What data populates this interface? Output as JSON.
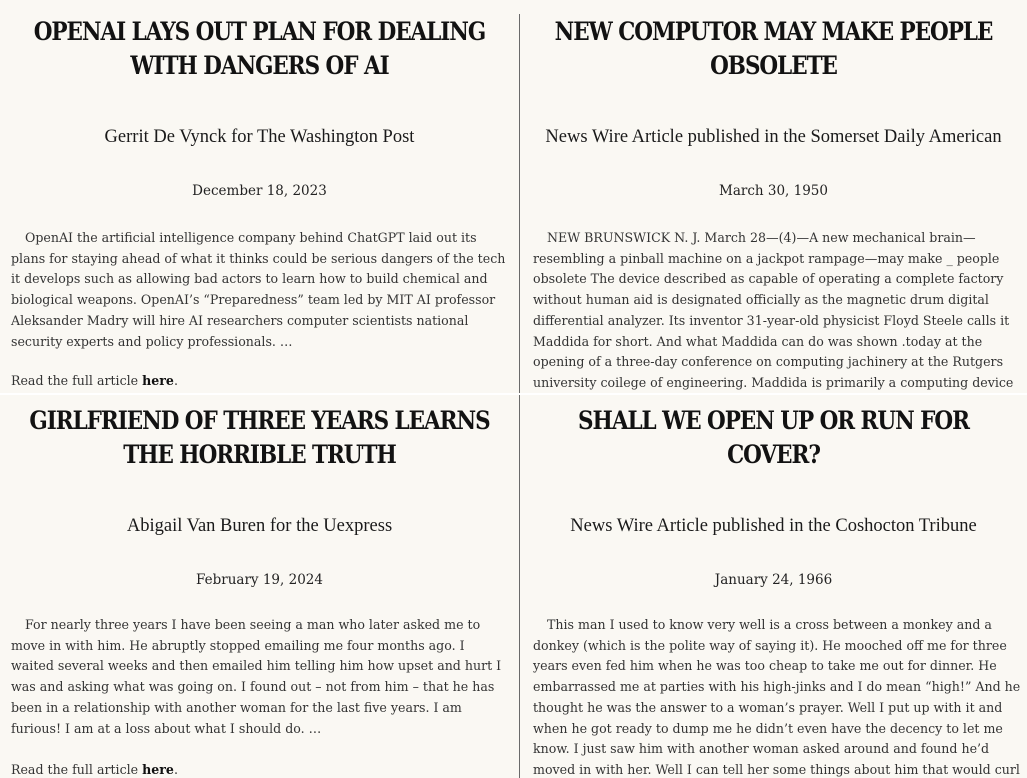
{
  "articles": [
    {
      "headline": "OpenAI lays out plan for dealing with dangers of AI",
      "byline": "Gerrit De Vynck for The Washington Post",
      "date": "December 18, 2023",
      "body": "OpenAI the artificial intelligence company behind ChatGPT laid out its plans for staying ahead of what it thinks could be serious dangers of the tech it develops such as allowing bad actors to learn how to build chemical and biological weapons. OpenAI’s “Preparedness” team led by MIT AI professor Aleksander Madry will hire AI researchers computer scientists national security experts and policy professionals. …",
      "read_prefix": "Read the full article ",
      "link_label": "here",
      "read_suffix": "."
    },
    {
      "headline": "New computor may make people obsolete",
      "byline": "News Wire Article published in the Somerset Daily American",
      "date": "March 30, 1950",
      "body": "NEW BRUNSWICK N. J. March 28—(4)—A new mechanical brain—resembling a pinball machine on a jackpot rampage—may make _ people obsolete The device described as capable of operating a complete factory without human aid is designated officially as the magnetic drum digital differential analyzer. Its inventor 31-year-old physicist Floyd Steele calls it Maddida for short. And what Maddida can do was shown .today at the opening of a three-day conference on computing jachinery at the Rutgers university coilege of engineering. Maddida is primarily a computing device"
    },
    {
      "headline": "Girlfriend of three years learns the horrible truth",
      "byline": "Abigail Van Buren for the Uexpress",
      "date": "February 19, 2024",
      "body": "For nearly three years I have been seeing a man who later asked me to move in with him. He abruptly stopped emailing me four months ago. I waited several weeks and then emailed him telling him how upset and hurt I was and asking what was going on. I found out – not from him – that he has been in a relationship with another woman for the last five years. I am furious! I am at a loss about what I should do. …",
      "read_prefix": "Read the full article ",
      "link_label": "here",
      "read_suffix": "."
    },
    {
      "headline": "Shall we open up or run for cover?",
      "byline": "News Wire Article published in the Coshocton Tribune",
      "date": "January 24, 1966",
      "body": "This man I used to know very well is a cross between a monkey and a donkey (which is the polite way of saying it). He mooched off me for three years even fed him when he was too cheap to take me out for dinner. He embarrassed me at parties with his high-jinks and I do mean “high!” And he thought he was the answer to a woman’s prayer. Well I put up with it and when he got ready to dump me he didn’t even have the decency to let me know. I just saw him with another woman asked around and found he’d moved in with her. Well I can tell her some things about him that would curl her fake"
    }
  ]
}
